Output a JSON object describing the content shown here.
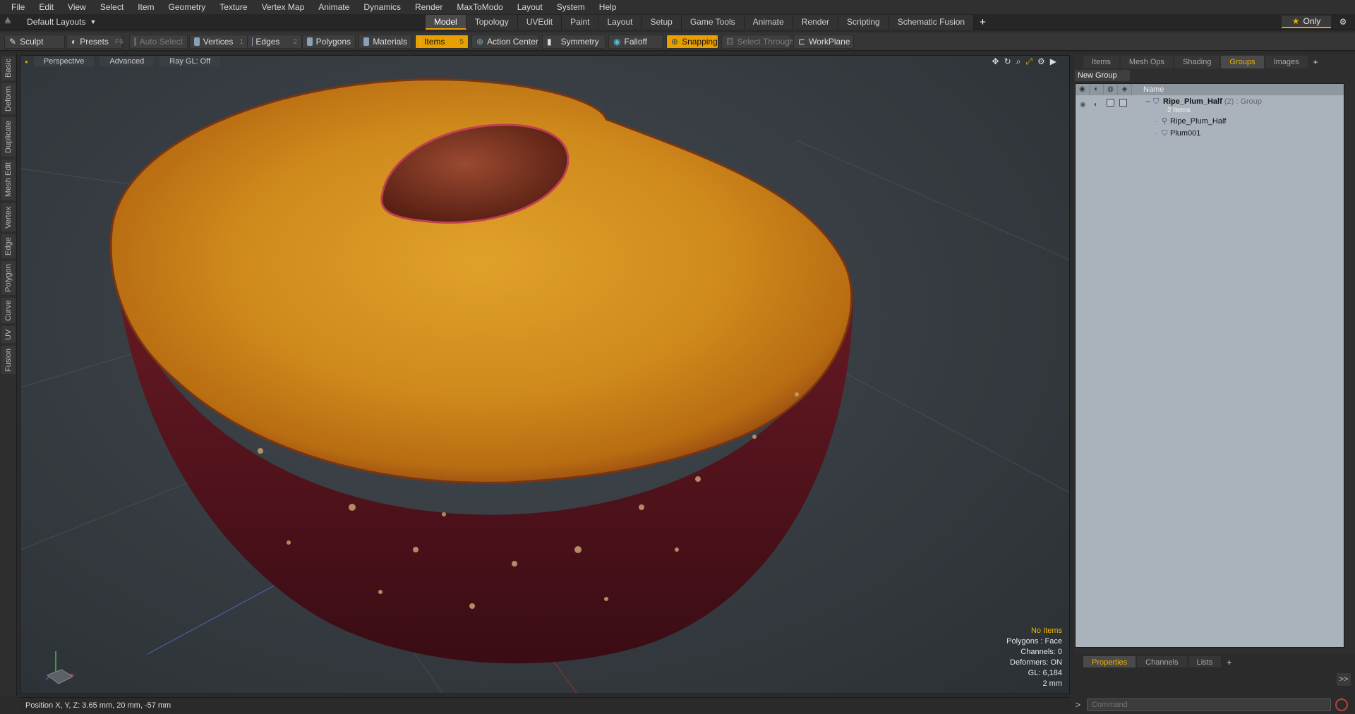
{
  "menu": [
    "File",
    "Edit",
    "View",
    "Select",
    "Item",
    "Geometry",
    "Texture",
    "Vertex Map",
    "Animate",
    "Dynamics",
    "Render",
    "MaxToModo",
    "Layout",
    "System",
    "Help"
  ],
  "layout": {
    "label": "Default Layouts"
  },
  "mode_tabs": [
    "Model",
    "Topology",
    "UVEdit",
    "Paint",
    "Layout",
    "Setup",
    "Game Tools",
    "Animate",
    "Render",
    "Scripting",
    "Schematic Fusion"
  ],
  "mode_tabs_active": "Model",
  "only_label": "Only",
  "toolbar": {
    "sculpt": "Sculpt",
    "presets": "Presets",
    "presets_key": "F6",
    "auto_select": "Auto Select",
    "vertices": "Vertices",
    "vertices_key": "1",
    "edges": "Edges",
    "edges_key": "2",
    "polygons": "Polygons",
    "materials": "Materials",
    "items": "Items",
    "items_key": "5",
    "action_center": "Action Center",
    "symmetry": "Symmetry",
    "falloff": "Falloff",
    "snapping": "Snapping",
    "select_through": "Select Through",
    "workplane": "WorkPlane"
  },
  "left_tabs": [
    "Basic",
    "Deform",
    "Duplicate",
    "Mesh Edit",
    "Vertex",
    "Edge",
    "Polygon",
    "Curve",
    "UV",
    "Fusion"
  ],
  "viewport": {
    "view": "Perspective",
    "advanced": "Advanced",
    "raygl": "Ray GL: Off",
    "hud": {
      "selection": "No Items",
      "polygons": "Polygons : Face",
      "channels": "Channels: 0",
      "deformers": "Deformers: ON",
      "gl": "GL: 6,184",
      "scale": "2 mm"
    }
  },
  "status": "Position X, Y, Z:  3.65 mm, 20 mm, -57 mm",
  "right_panel": {
    "tabs": [
      "Items",
      "Mesh Ops",
      "Shading",
      "Groups",
      "Images"
    ],
    "active_tab": "Groups",
    "new_group": "New Group",
    "col_name": "Name",
    "group_name": "Ripe_Plum_Half",
    "group_count": "(2)",
    "group_type": ": Group",
    "group_sub": "2 Items",
    "children": [
      "Ripe_Plum_Half",
      "Plum001"
    ]
  },
  "bottom_tabs": [
    "Properties",
    "Channels",
    "Lists"
  ],
  "bottom_active": "Properties",
  "command_placeholder": "Command"
}
